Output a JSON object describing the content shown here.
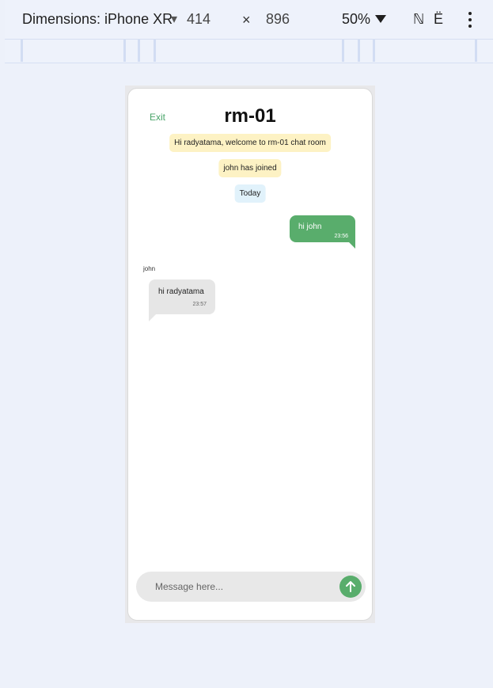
{
  "devtools": {
    "dimensions_label": "Dimensions: iPhone XR",
    "dropdown_caret": "▾",
    "width": "414",
    "times": "×",
    "height": "896",
    "zoom": "50%",
    "throttle_glyph": "ℕ",
    "rotate_glyph": "Ë"
  },
  "chat": {
    "exit_label": "Exit",
    "room_title": "rm-01",
    "system_messages": [
      "Hi radyatama, welcome to rm-01 chat room",
      "john has joined",
      "Today"
    ],
    "outgoing": {
      "text": "hi john",
      "time": "23:56"
    },
    "incoming": {
      "sender": "john",
      "text": "hi radyatama",
      "time": "23:57"
    },
    "composer": {
      "placeholder": "Message here...",
      "value": ""
    }
  },
  "colors": {
    "accent_green": "#59ad6c",
    "system_yellow": "#fdf2c4",
    "system_blue": "#e1f2fb",
    "incoming_bubble": "#e6e6e6"
  },
  "icons": {
    "send": "arrow-up-icon",
    "more": "kebab-menu-icon",
    "zoom_dropdown": "triangle-down-icon"
  }
}
